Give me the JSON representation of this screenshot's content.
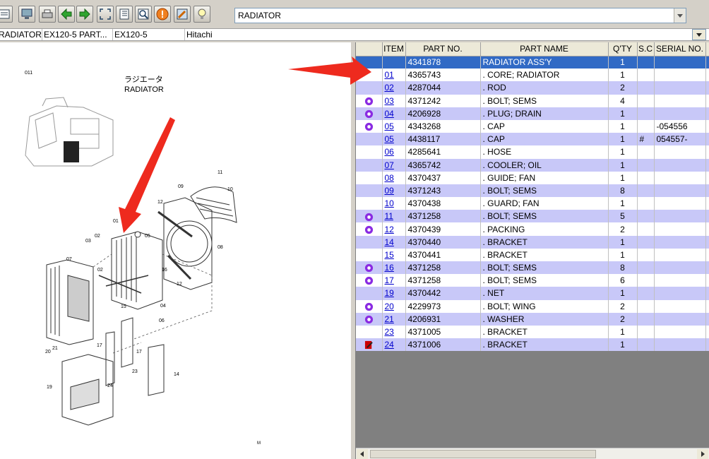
{
  "toolbar": {
    "buttons": [
      "print-icon",
      "monitor-icon",
      "printer-icon",
      "back-arrow-icon",
      "forward-arrow-icon",
      "fit-screen-icon",
      "list-view-icon",
      "zoom-icon",
      "info-icon",
      "settings-icon",
      "tip-bulb-icon"
    ],
    "search_value": "RADIATOR"
  },
  "breadcrumb": [
    "RADIATOR",
    "EX120-5  PART...",
    "EX120-5",
    "Hitachi"
  ],
  "diagram": {
    "page_code": "011",
    "title_jp": "ラジエータ",
    "title_en": "RADIATOR",
    "callouts": [
      "11",
      "10",
      "09",
      "12",
      "08",
      "01",
      "05",
      "03",
      "02",
      "07",
      "02",
      "16",
      "12",
      "04",
      "15",
      "06",
      "17",
      "20",
      "21",
      "17",
      "23",
      "14",
      "19",
      "24"
    ],
    "corner_mark": "M"
  },
  "table": {
    "columns": [
      "",
      "ITEM",
      "PART NO.",
      "PART NAME",
      "Q'TY",
      "S.C",
      "SERIAL NO.",
      "I"
    ],
    "rows": [
      {
        "icon": "",
        "item": "",
        "part_no": "4341878",
        "name": "RADIATOR ASS'Y",
        "qty": "1",
        "sc": "",
        "serial": ""
      },
      {
        "icon": "",
        "item": "01",
        "part_no": "4365743",
        "name": ". CORE; RADIATOR",
        "qty": "1",
        "sc": "",
        "serial": ""
      },
      {
        "icon": "",
        "item": "02",
        "part_no": "4287044",
        "name": ". ROD",
        "qty": "2",
        "sc": "",
        "serial": ""
      },
      {
        "icon": "gear",
        "item": "03",
        "part_no": "4371242",
        "name": ". BOLT; SEMS",
        "qty": "4",
        "sc": "",
        "serial": ""
      },
      {
        "icon": "gear",
        "item": "04",
        "part_no": "4206928",
        "name": ". PLUG; DRAIN",
        "qty": "1",
        "sc": "",
        "serial": ""
      },
      {
        "icon": "gear",
        "item": "05",
        "part_no": "4343268",
        "name": ". CAP",
        "qty": "1",
        "sc": "",
        "serial": "-054556"
      },
      {
        "icon": "",
        "item": "05",
        "part_no": "4438117",
        "name": ". CAP",
        "qty": "1",
        "sc": "#",
        "serial": "054557-"
      },
      {
        "icon": "",
        "item": "06",
        "part_no": "4285641",
        "name": ". HOSE",
        "qty": "1",
        "sc": "",
        "serial": ""
      },
      {
        "icon": "",
        "item": "07",
        "part_no": "4365742",
        "name": ". COOLER; OIL",
        "qty": "1",
        "sc": "",
        "serial": ""
      },
      {
        "icon": "",
        "item": "08",
        "part_no": "4370437",
        "name": ". GUIDE; FAN",
        "qty": "1",
        "sc": "",
        "serial": ""
      },
      {
        "icon": "",
        "item": "09",
        "part_no": "4371243",
        "name": ". BOLT; SEMS",
        "qty": "8",
        "sc": "",
        "serial": ""
      },
      {
        "icon": "",
        "item": "10",
        "part_no": "4370438",
        "name": ". GUARD; FAN",
        "qty": "1",
        "sc": "",
        "serial": ""
      },
      {
        "icon": "gear",
        "item": "11",
        "part_no": "4371258",
        "name": ". BOLT; SEMS",
        "qty": "5",
        "sc": "",
        "serial": ""
      },
      {
        "icon": "gear",
        "item": "12",
        "part_no": "4370439",
        "name": ". PACKING",
        "qty": "2",
        "sc": "",
        "serial": ""
      },
      {
        "icon": "",
        "item": "14",
        "part_no": "4370440",
        "name": ". BRACKET",
        "qty": "1",
        "sc": "",
        "serial": ""
      },
      {
        "icon": "",
        "item": "15",
        "part_no": "4370441",
        "name": ". BRACKET",
        "qty": "1",
        "sc": "",
        "serial": ""
      },
      {
        "icon": "gear",
        "item": "16",
        "part_no": "4371258",
        "name": ". BOLT; SEMS",
        "qty": "8",
        "sc": "",
        "serial": ""
      },
      {
        "icon": "gear",
        "item": "17",
        "part_no": "4371258",
        "name": ". BOLT; SEMS",
        "qty": "6",
        "sc": "",
        "serial": ""
      },
      {
        "icon": "",
        "item": "19",
        "part_no": "4370442",
        "name": ". NET",
        "qty": "1",
        "sc": "",
        "serial": ""
      },
      {
        "icon": "gear",
        "item": "20",
        "part_no": "4229973",
        "name": ". BOLT; WING",
        "qty": "2",
        "sc": "",
        "serial": ""
      },
      {
        "icon": "gear",
        "item": "21",
        "part_no": "4206931",
        "name": ". WASHER",
        "qty": "2",
        "sc": "",
        "serial": ""
      },
      {
        "icon": "",
        "item": "23",
        "part_no": "4371005",
        "name": ". BRACKET",
        "qty": "1",
        "sc": "",
        "serial": ""
      },
      {
        "icon": "edit",
        "item": "24",
        "part_no": "4371006",
        "name": ". BRACKET",
        "qty": "1",
        "sc": "",
        "serial": ""
      }
    ]
  },
  "colors": {
    "selected_row": "#316ac5",
    "alt_row": "#c8c8f8",
    "link": "#0000cc",
    "gear_icon": "#8a2be2",
    "callout_arrow": "#ee2a1e"
  }
}
